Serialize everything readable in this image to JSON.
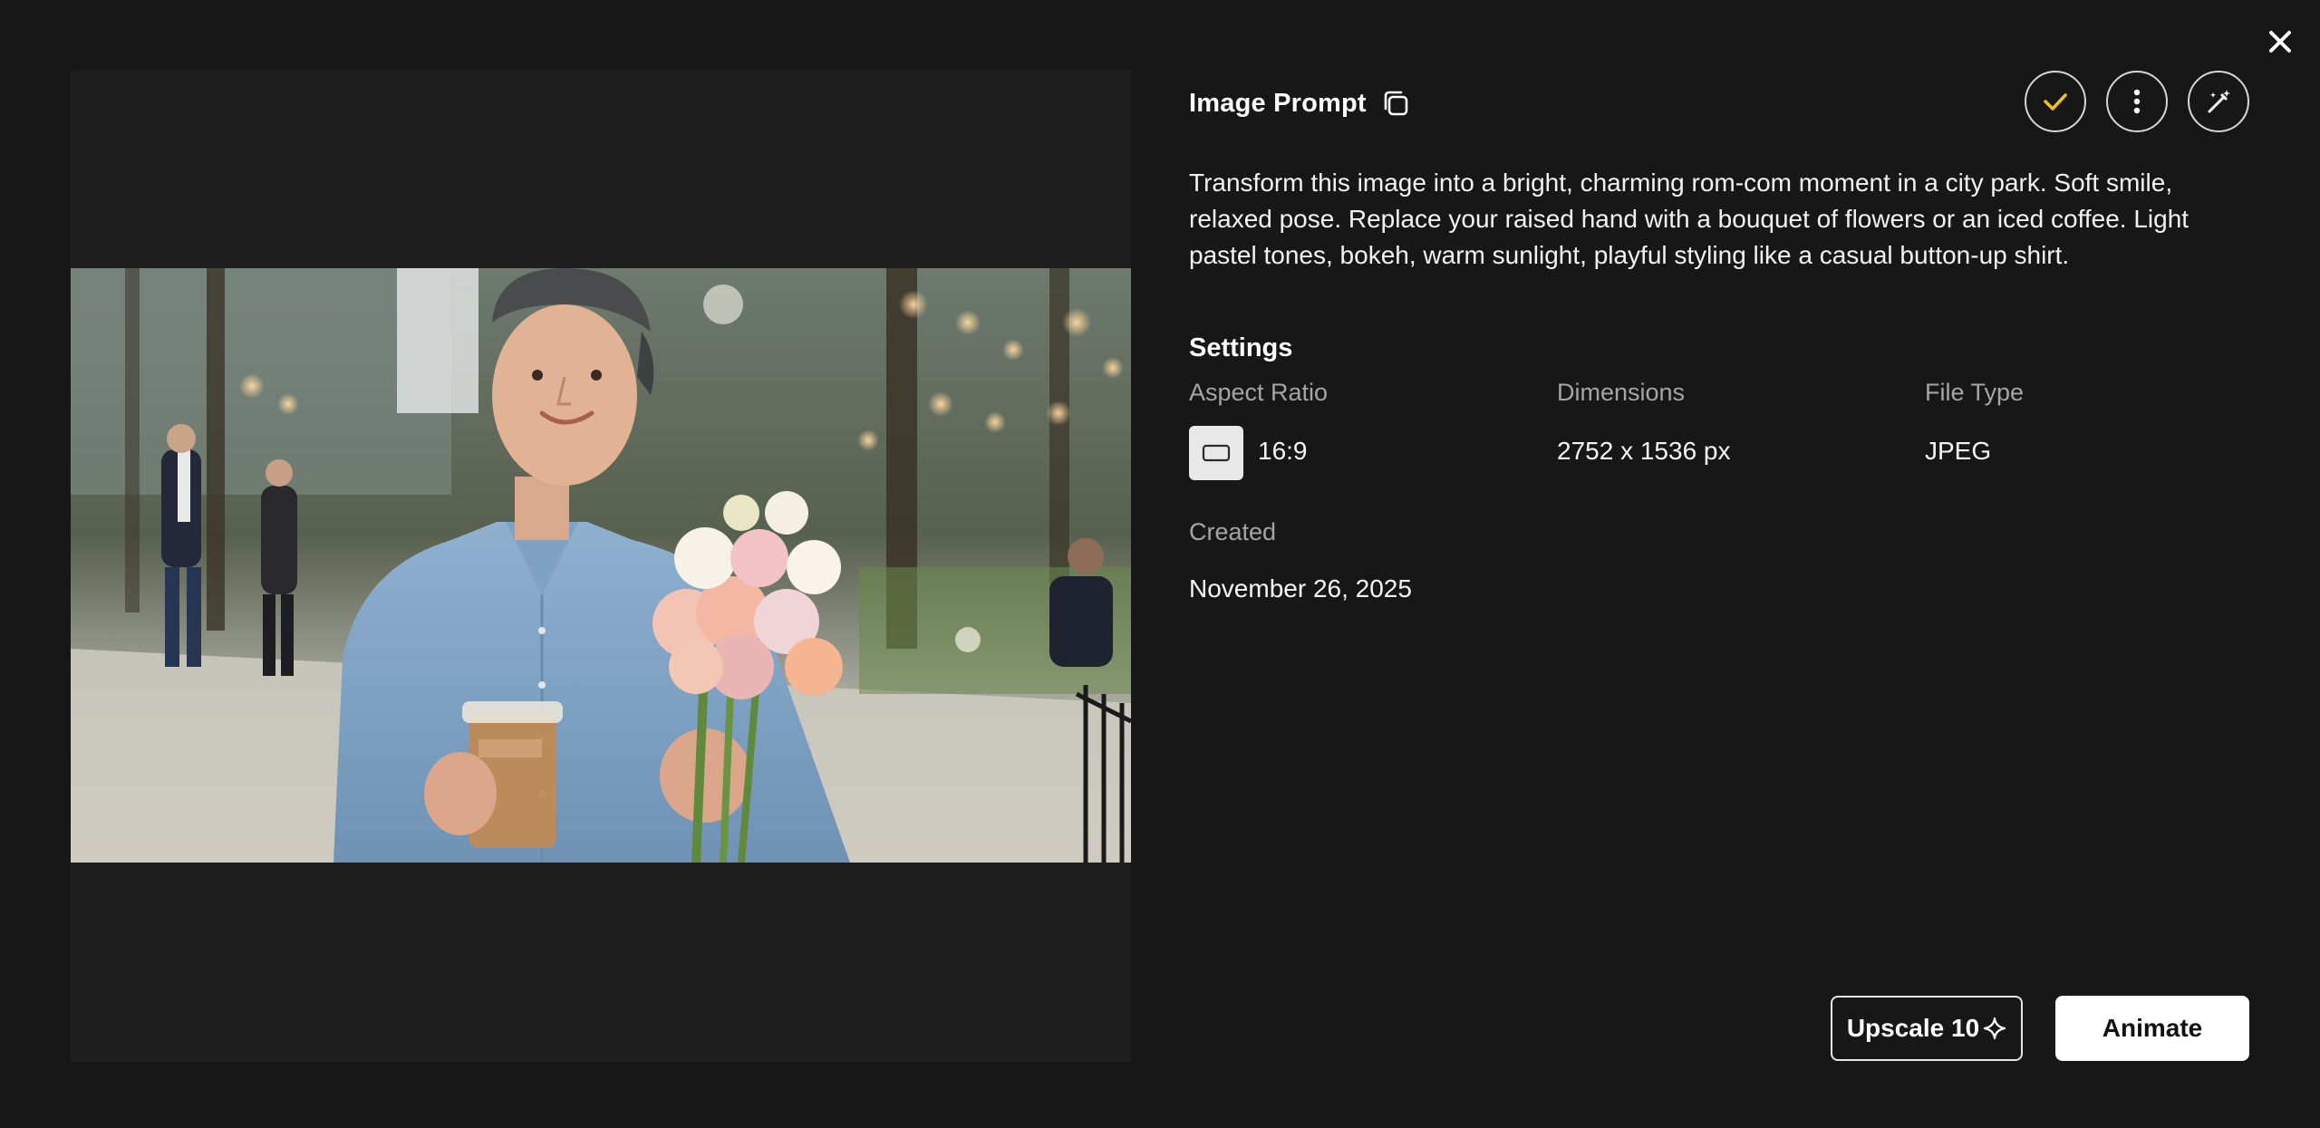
{
  "window": {
    "close_icon": "close-icon"
  },
  "preview": {
    "alt": "Smiling man in a backwards cap and light blue shirt holding an iced coffee and a pastel flower bouquet in a sunny city park"
  },
  "prompt": {
    "title": "Image Prompt",
    "copy_icon": "copy-icon",
    "text": "Transform this image into a bright, charming rom-com moment in a city park. Soft smile, relaxed pose. Replace your raised hand with a bouquet of flowers or an iced coffee. Light pastel tones, bokeh, warm sunlight, playful styling like a casual button-up shirt."
  },
  "actions": {
    "check_icon": "check-icon",
    "more_icon": "more-vertical-icon",
    "magic_icon": "magic-wand-icon",
    "accent_color": "#f0c419"
  },
  "settings": {
    "title": "Settings",
    "aspect_ratio_label": "Aspect Ratio",
    "aspect_ratio_value": "16:9",
    "dimensions_label": "Dimensions",
    "dimensions_value": "2752 x 1536 px",
    "file_type_label": "File Type",
    "file_type_value": "JPEG",
    "created_label": "Created",
    "created_value": "November 26, 2025"
  },
  "buttons": {
    "upscale_label": "Upscale 10",
    "upscale_icon": "sparkle-icon",
    "animate_label": "Animate"
  }
}
